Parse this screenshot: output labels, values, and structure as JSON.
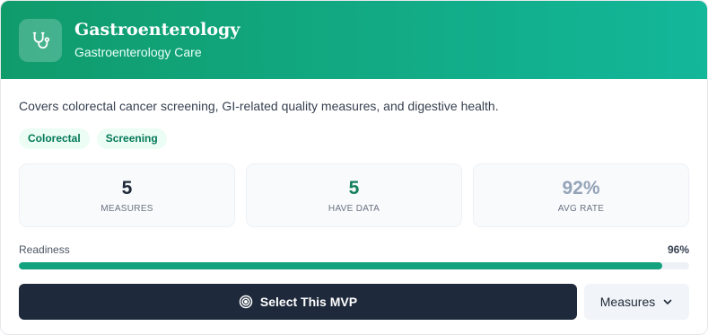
{
  "header": {
    "title": "Gastroenterology",
    "subtitle": "Gastroenterology Care",
    "icon": "stethoscope-icon"
  },
  "description": "Covers colorectal cancer screening, GI-related quality measures, and digestive health.",
  "tags": [
    "Colorectal",
    "Screening"
  ],
  "stats": [
    {
      "value": "5",
      "label": "MEASURES",
      "color": "#1f2937"
    },
    {
      "value": "5",
      "label": "HAVE DATA",
      "color": "#15805a"
    },
    {
      "value": "92%",
      "label": "AVG RATE",
      "color": "#94a3b8"
    }
  ],
  "readiness": {
    "label": "Readiness",
    "percent_text": "96%",
    "value": 0.96
  },
  "actions": {
    "primary_label": "Select This MVP",
    "primary_icon": "target-icon",
    "secondary_label": "Measures",
    "secondary_icon": "chevron-down-icon"
  },
  "colors": {
    "brand": "#109b6b",
    "accent": "#14a37f",
    "dark": "#1e293b"
  }
}
